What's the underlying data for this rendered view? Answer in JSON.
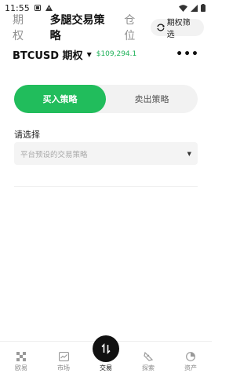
{
  "status_bar": {
    "time": "11:55"
  },
  "tabs": {
    "options": "期权",
    "multi_leg": "多腿交易策略",
    "positions": "仓位",
    "filter_label": "期权筛选"
  },
  "symbol": {
    "name": "BTCUSD 期权",
    "price": "$109,294.1"
  },
  "toggle": {
    "buy": "买入策略",
    "sell": "卖出策略"
  },
  "select": {
    "label": "请选择",
    "placeholder": "平台预设的交易策略"
  },
  "nav": [
    {
      "label": "欧易"
    },
    {
      "label": "市场"
    },
    {
      "label": "交易"
    },
    {
      "label": "探索"
    },
    {
      "label": "资产"
    }
  ],
  "colors": {
    "accent": "#21bd5c",
    "price": "#20b25a"
  }
}
